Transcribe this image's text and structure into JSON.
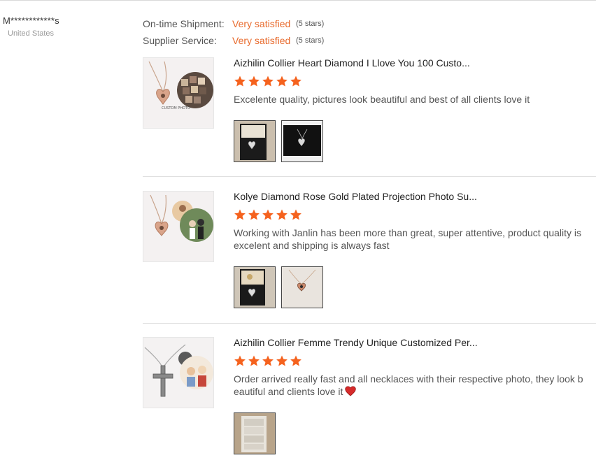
{
  "buyer": {
    "name": "M************s",
    "country": "United States"
  },
  "ratings": [
    {
      "label": "On-time Shipment:",
      "value": "Very satisfied",
      "stars": "(5 stars)"
    },
    {
      "label": "Supplier Service:",
      "value": "Very satisfied",
      "stars": "(5 stars)"
    }
  ],
  "colors": {
    "accent": "#e86a2c",
    "star": "#f5621e",
    "heart": "#d62b2b"
  },
  "reviews": [
    {
      "title": "Aizhilin Collier Heart Diamond I Llove You 100 Custo...",
      "rating": 5,
      "text": "Excelente quality, pictures look beautiful and best of all clients love it",
      "product_icon": "heart-projection-necklace-icon",
      "photos": [
        "necklace-box-photo",
        "necklace-dark-photo"
      ]
    },
    {
      "title": "Kolye Diamond Rose Gold Plated Projection Photo Su...",
      "rating": 5,
      "text": "Working with Janlin has been more than great, super attentive, product quality is excelent and shipping is always fast",
      "product_icon": "rose-gold-projection-necklace-icon",
      "photos": [
        "necklace-box-photo",
        "necklace-card-photo"
      ]
    },
    {
      "title": "Aizhilin Collier Femme Trendy Unique Customized Per...",
      "rating": 5,
      "text": "Order arrived really fast and all necklaces with their respective photo, they look beautiful and clients love it",
      "emoji": "heart-emoji",
      "product_icon": "cross-projection-necklace-icon",
      "photos": [
        "package-photo"
      ]
    }
  ]
}
